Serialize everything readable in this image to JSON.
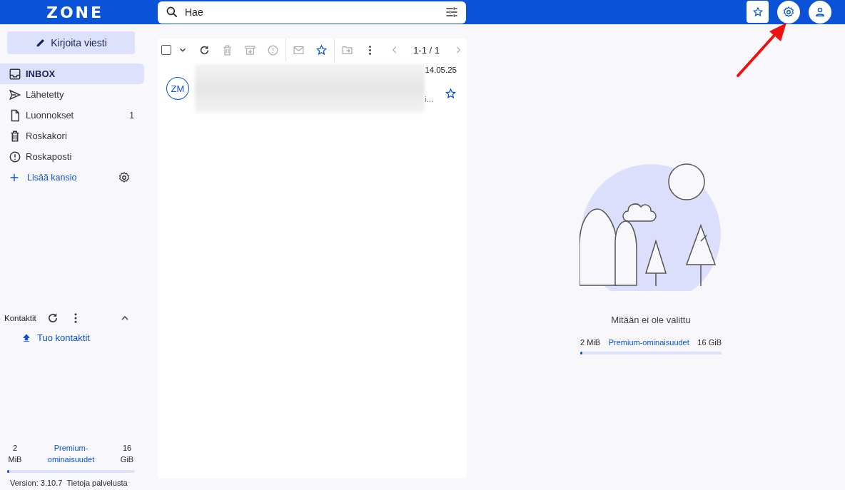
{
  "header": {
    "logo": "ZONE",
    "search": {
      "placeholder": "Hae"
    }
  },
  "sidebar": {
    "compose": "Kirjoita viesti",
    "folders": [
      {
        "kind": "inbox",
        "label": "INBOX",
        "selected": true
      },
      {
        "kind": "sent",
        "label": "Lähetetty",
        "selected": false
      },
      {
        "kind": "drafts",
        "label": "Luonnokset",
        "count": "1",
        "selected": false
      },
      {
        "kind": "trash",
        "label": "Roskakori",
        "selected": false
      },
      {
        "kind": "spam",
        "label": "Roskaposti",
        "selected": false
      }
    ],
    "add_folder": "Lisää kansio",
    "contacts": {
      "title": "Kontaktit",
      "import": "Tuo kontaktit"
    },
    "storage": {
      "used": [
        "2",
        "MiB"
      ],
      "premium": [
        "Premium-",
        "ominaisuudet"
      ],
      "total": [
        "16",
        "GiB"
      ],
      "level": 0.01
    },
    "version": "Version: 3.10.7",
    "about": "Tietoja palvelusta"
  },
  "mail_list": {
    "select_all": {
      "checked": false
    },
    "pager": "1-1 / 1",
    "messages": [
      {
        "initials": "ZM",
        "date": "14.05.25",
        "snippet": "i…",
        "starred": false
      }
    ]
  },
  "reading_pane": {
    "empty_text": "Mitään ei ole valittu",
    "storage": {
      "used": "2 MiB",
      "premium": "Premium-ominaisuudet",
      "total": "16 GiB",
      "level": 0.01
    }
  }
}
